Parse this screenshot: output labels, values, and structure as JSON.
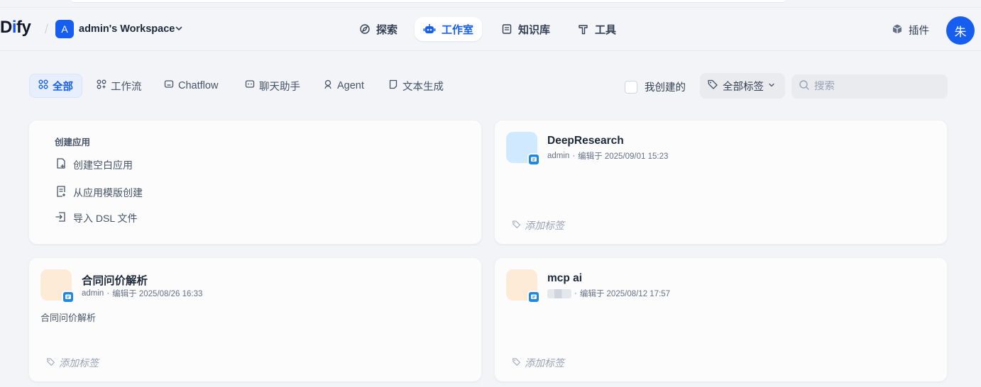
{
  "header": {
    "logo": {
      "prefix": "D",
      "highlight": "i",
      "suffix": "fy"
    },
    "separator": "/",
    "workspace": {
      "badge": "A",
      "name": "admin's Workspace"
    },
    "nav": [
      {
        "label": "探索",
        "icon": "compass-icon"
      },
      {
        "label": "工作室",
        "icon": "robot-icon",
        "active": true
      },
      {
        "label": "知识库",
        "icon": "book-icon"
      },
      {
        "label": "工具",
        "icon": "hammer-icon"
      }
    ],
    "plugins_label": "插件",
    "avatar": "朱"
  },
  "filters": {
    "tabs": [
      {
        "label": "全部",
        "icon": "grid-icon",
        "active": true
      },
      {
        "label": "工作流",
        "icon": "workflow-icon"
      },
      {
        "label": "Chatflow",
        "icon": "chatflow-icon"
      },
      {
        "label": "聊天助手",
        "icon": "chat-icon"
      },
      {
        "label": "Agent",
        "icon": "agent-icon"
      },
      {
        "label": "文本生成",
        "icon": "text-doc-icon"
      }
    ],
    "created_by_me": "我创建的",
    "all_tags": "全部标签",
    "search_placeholder": "搜索"
  },
  "create_card": {
    "title": "创建应用",
    "items": [
      "创建空白应用",
      "从应用模版创建",
      "导入 DSL 文件"
    ]
  },
  "apps": [
    {
      "name": "DeepResearch",
      "author": "admin",
      "edited": "编辑于 2025/09/01 15:23",
      "description": "",
      "icon_bg": "#d1e9ff",
      "add_tag": "添加标签"
    },
    {
      "name": "合同问价解析",
      "author": "admin",
      "edited": "编辑于 2025/08/26 16:33",
      "description": "合同问价解析",
      "icon_bg": "#fdead7",
      "add_tag": "添加标签"
    },
    {
      "name": "mcp ai",
      "author": "",
      "edited": "编辑于 2025/08/12 17:57",
      "description": "",
      "icon_bg": "#fdead7",
      "add_tag": "添加标签"
    }
  ],
  "meta_separator": "·"
}
